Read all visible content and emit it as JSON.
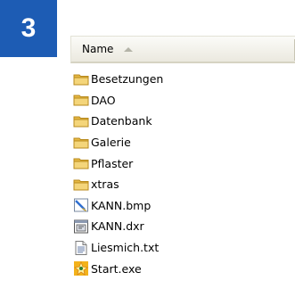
{
  "step": {
    "number": "3"
  },
  "explorer": {
    "column_header": "Name",
    "sort_direction": "ascending",
    "items": [
      {
        "name": "Besetzungen",
        "type": "folder"
      },
      {
        "name": "DAO",
        "type": "folder"
      },
      {
        "name": "Datenbank",
        "type": "folder"
      },
      {
        "name": "Galerie",
        "type": "folder"
      },
      {
        "name": "Pflaster",
        "type": "folder"
      },
      {
        "name": "xtras",
        "type": "folder"
      },
      {
        "name": "KANN.bmp",
        "type": "bitmap-file"
      },
      {
        "name": "KANN.dxr",
        "type": "director-file"
      },
      {
        "name": "Liesmich.txt",
        "type": "text-file"
      },
      {
        "name": "Start.exe",
        "type": "executable-file"
      }
    ]
  },
  "colors": {
    "badge": "#1d5cb4",
    "folder": "#f0c75e",
    "header_bg": "#ebe9df"
  }
}
